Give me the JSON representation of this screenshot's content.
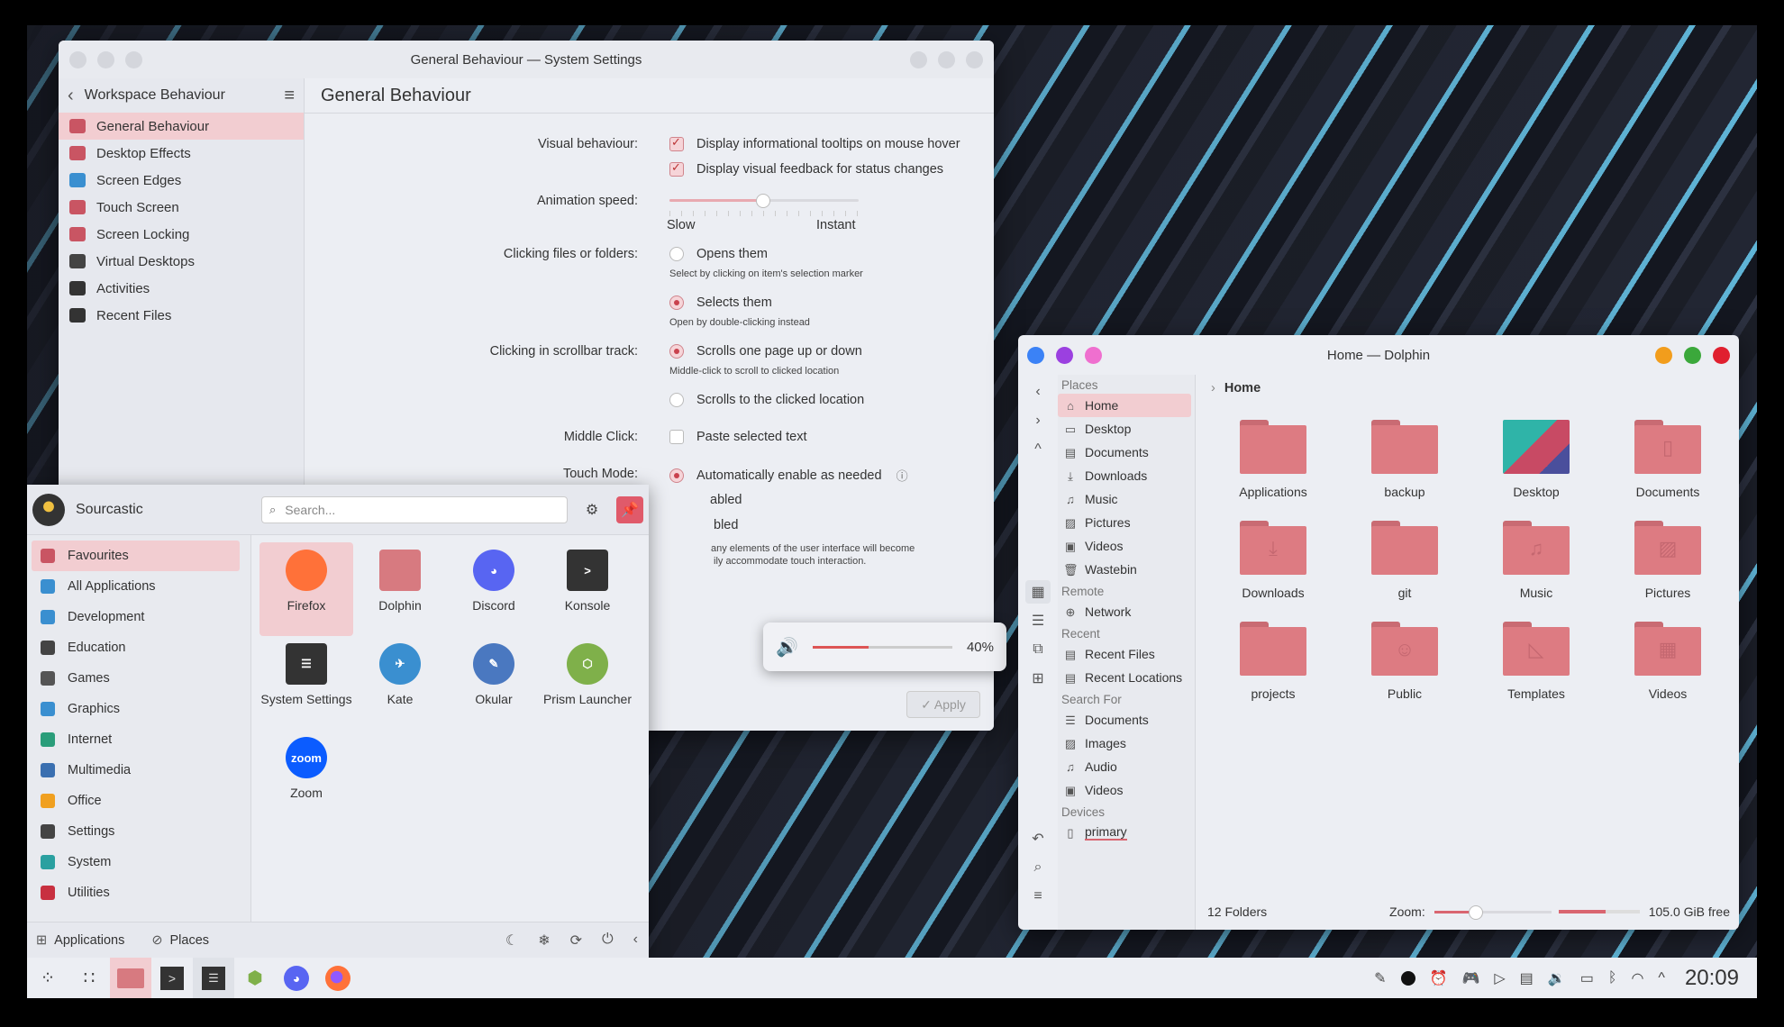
{
  "settings": {
    "window_title": "General Behaviour — System Settings",
    "sidebar_header": "Workspace Behaviour",
    "sidebar_items": [
      {
        "label": "General Behaviour",
        "color": "#c95563",
        "active": true
      },
      {
        "label": "Desktop Effects",
        "color": "#c95563"
      },
      {
        "label": "Screen Edges",
        "color": "#3a8fd0"
      },
      {
        "label": "Touch Screen",
        "color": "#c95563"
      },
      {
        "label": "Screen Locking",
        "color": "#c95563"
      },
      {
        "label": "Virtual Desktops",
        "color": "#444"
      },
      {
        "label": "Activities",
        "color": "#333"
      },
      {
        "label": "Recent Files",
        "color": "#333"
      }
    ],
    "page_title": "General Behaviour",
    "visual_label": "Visual behaviour:",
    "tooltips": "Display informational tooltips on mouse hover",
    "feedback": "Display visual feedback for status changes",
    "anim_label": "Animation speed:",
    "anim_slow": "Slow",
    "anim_instant": "Instant",
    "click_label": "Clicking files or folders:",
    "opens_them": "Opens them",
    "opens_hint": "Select by clicking on item's selection marker",
    "selects_them": "Selects them",
    "selects_hint": "Open by double-clicking instead",
    "scroll_label": "Clicking in scrollbar track:",
    "scroll_page": "Scrolls one page up or down",
    "scroll_hint": "Middle-click to scroll to clicked location",
    "scroll_loc": "Scrolls to the clicked location",
    "middle_label": "Middle Click:",
    "paste": "Paste selected text",
    "touch_label": "Touch Mode:",
    "touch_auto": "Automatically enable as needed",
    "touch_enabled_partial": "abled",
    "touch_disabled_partial": "bled",
    "touch_desc_1": "any elements of the user interface will become",
    "touch_desc_2": "ily accommodate touch interaction.",
    "apply": "✓ Apply"
  },
  "osd": {
    "percent": "40%",
    "level": 0.4
  },
  "launcher": {
    "user": "Sourcastic",
    "search_placeholder": "Search...",
    "categories": [
      {
        "label": "Favourites",
        "color": "#c95563",
        "active": true
      },
      {
        "label": "All Applications",
        "color": "#3a8fd0"
      },
      {
        "label": "Development",
        "color": "#3a8fd0"
      },
      {
        "label": "Education",
        "color": "#444"
      },
      {
        "label": "Games",
        "color": "#555"
      },
      {
        "label": "Graphics",
        "color": "#3a8fd0"
      },
      {
        "label": "Internet",
        "color": "#2a9d7a"
      },
      {
        "label": "Multimedia",
        "color": "#3a6fb0"
      },
      {
        "label": "Office",
        "color": "#f0a020"
      },
      {
        "label": "Settings",
        "color": "#444"
      },
      {
        "label": "System",
        "color": "#2aa0a0"
      },
      {
        "label": "Utilities",
        "color": "#c83040"
      }
    ],
    "apps": [
      {
        "label": "Firefox",
        "color": "#ff7139",
        "glyph": "",
        "active": true
      },
      {
        "label": "Dolphin",
        "color": "#d77a80",
        "glyph": ""
      },
      {
        "label": "Discord",
        "color": "#5865f2",
        "glyph": "◕"
      },
      {
        "label": "Konsole",
        "color": "#333",
        "glyph": ">"
      },
      {
        "label": "System Settings",
        "color": "#333",
        "glyph": "☰"
      },
      {
        "label": "Kate",
        "color": "#3a8fd0",
        "glyph": "✈"
      },
      {
        "label": "Okular",
        "color": "#4a78c0",
        "glyph": "✎"
      },
      {
        "label": "Prism Launcher",
        "color": "#7fb04a",
        "glyph": "⬡"
      },
      {
        "label": "Zoom",
        "color": "#0b5cff",
        "glyph": "zoom"
      }
    ],
    "footer_apps": "Applications",
    "footer_places": "Places"
  },
  "dolphin": {
    "window_title": "Home — Dolphin",
    "breadcrumb": "Home",
    "places_heading": "Places",
    "places": [
      "Home",
      "Desktop",
      "Documents",
      "Downloads",
      "Music",
      "Pictures",
      "Videos",
      "Wastebin"
    ],
    "places_icons": [
      "⌂",
      "▭",
      "▤",
      "⤓",
      "♫",
      "▨",
      "▣",
      "🗑"
    ],
    "remote_heading": "Remote",
    "remote": [
      "Network"
    ],
    "recent_heading": "Recent",
    "recent": [
      "Recent Files",
      "Recent Locations"
    ],
    "search_heading": "Search For",
    "search": [
      "Documents",
      "Images",
      "Audio",
      "Videos"
    ],
    "devices_heading": "Devices",
    "devices": [
      "primary"
    ],
    "folders": [
      {
        "label": "Applications",
        "glyph": ""
      },
      {
        "label": "backup",
        "glyph": ""
      },
      {
        "label": "Desktop",
        "glyph": "desk"
      },
      {
        "label": "Documents",
        "glyph": "▯"
      },
      {
        "label": "Downloads",
        "glyph": "⤓"
      },
      {
        "label": "git",
        "glyph": ""
      },
      {
        "label": "Music",
        "glyph": "♫"
      },
      {
        "label": "Pictures",
        "glyph": "▨"
      },
      {
        "label": "projects",
        "glyph": ""
      },
      {
        "label": "Public",
        "glyph": "☺"
      },
      {
        "label": "Templates",
        "glyph": "◺"
      },
      {
        "label": "Videos",
        "glyph": "▦"
      }
    ],
    "status_count": "12 Folders",
    "zoom_label": "Zoom:",
    "free_space": "105.0 GiB free"
  },
  "taskbar": {
    "clock": "20:09"
  },
  "colors": {
    "accent": "#dd7b82",
    "highlight": "#f2cdd1"
  }
}
